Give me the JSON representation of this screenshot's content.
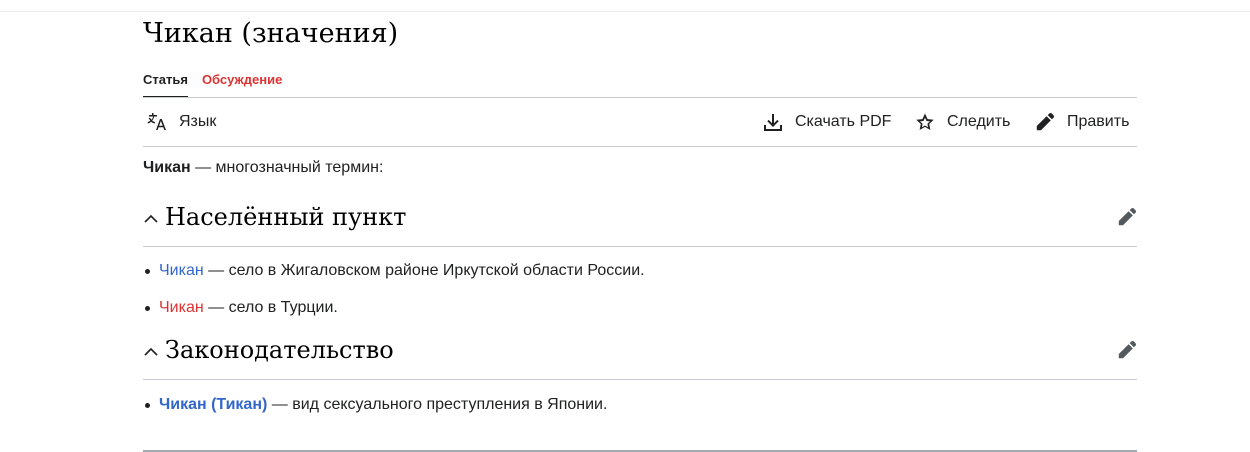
{
  "page": {
    "title": "Чикан (значения)"
  },
  "tabs": [
    {
      "label": "Статья",
      "state": "active"
    },
    {
      "label": "Обсуждение",
      "state": "new"
    }
  ],
  "toolbar": {
    "language": {
      "label": "Язык",
      "icon": "language-icon"
    },
    "download_pdf": {
      "label": "Скачать PDF",
      "icon": "download-icon"
    },
    "watch": {
      "label": "Следить",
      "icon": "star-icon"
    },
    "edit": {
      "label": "Править",
      "icon": "pencil-icon"
    }
  },
  "lead": {
    "term": "Чикан",
    "rest": " — многозначный термин:"
  },
  "sections": [
    {
      "heading": "Населённый пункт",
      "items": [
        {
          "link": "Чикан",
          "link_kind": "blue",
          "text": " — село в Жигаловском районе Иркутской области России."
        },
        {
          "link": "Чикан",
          "link_kind": "red",
          "text": " — село в Турции."
        }
      ]
    },
    {
      "heading": "Законодательство",
      "items": [
        {
          "link": "Чикан (Тикан)",
          "link_kind": "blue-bold",
          "text": " — вид сексуального преступления в Японии."
        }
      ]
    }
  ],
  "colors": {
    "link": "#3366cc",
    "redlink": "#d33333",
    "text": "#202122",
    "divider": "#c8ccd1"
  }
}
